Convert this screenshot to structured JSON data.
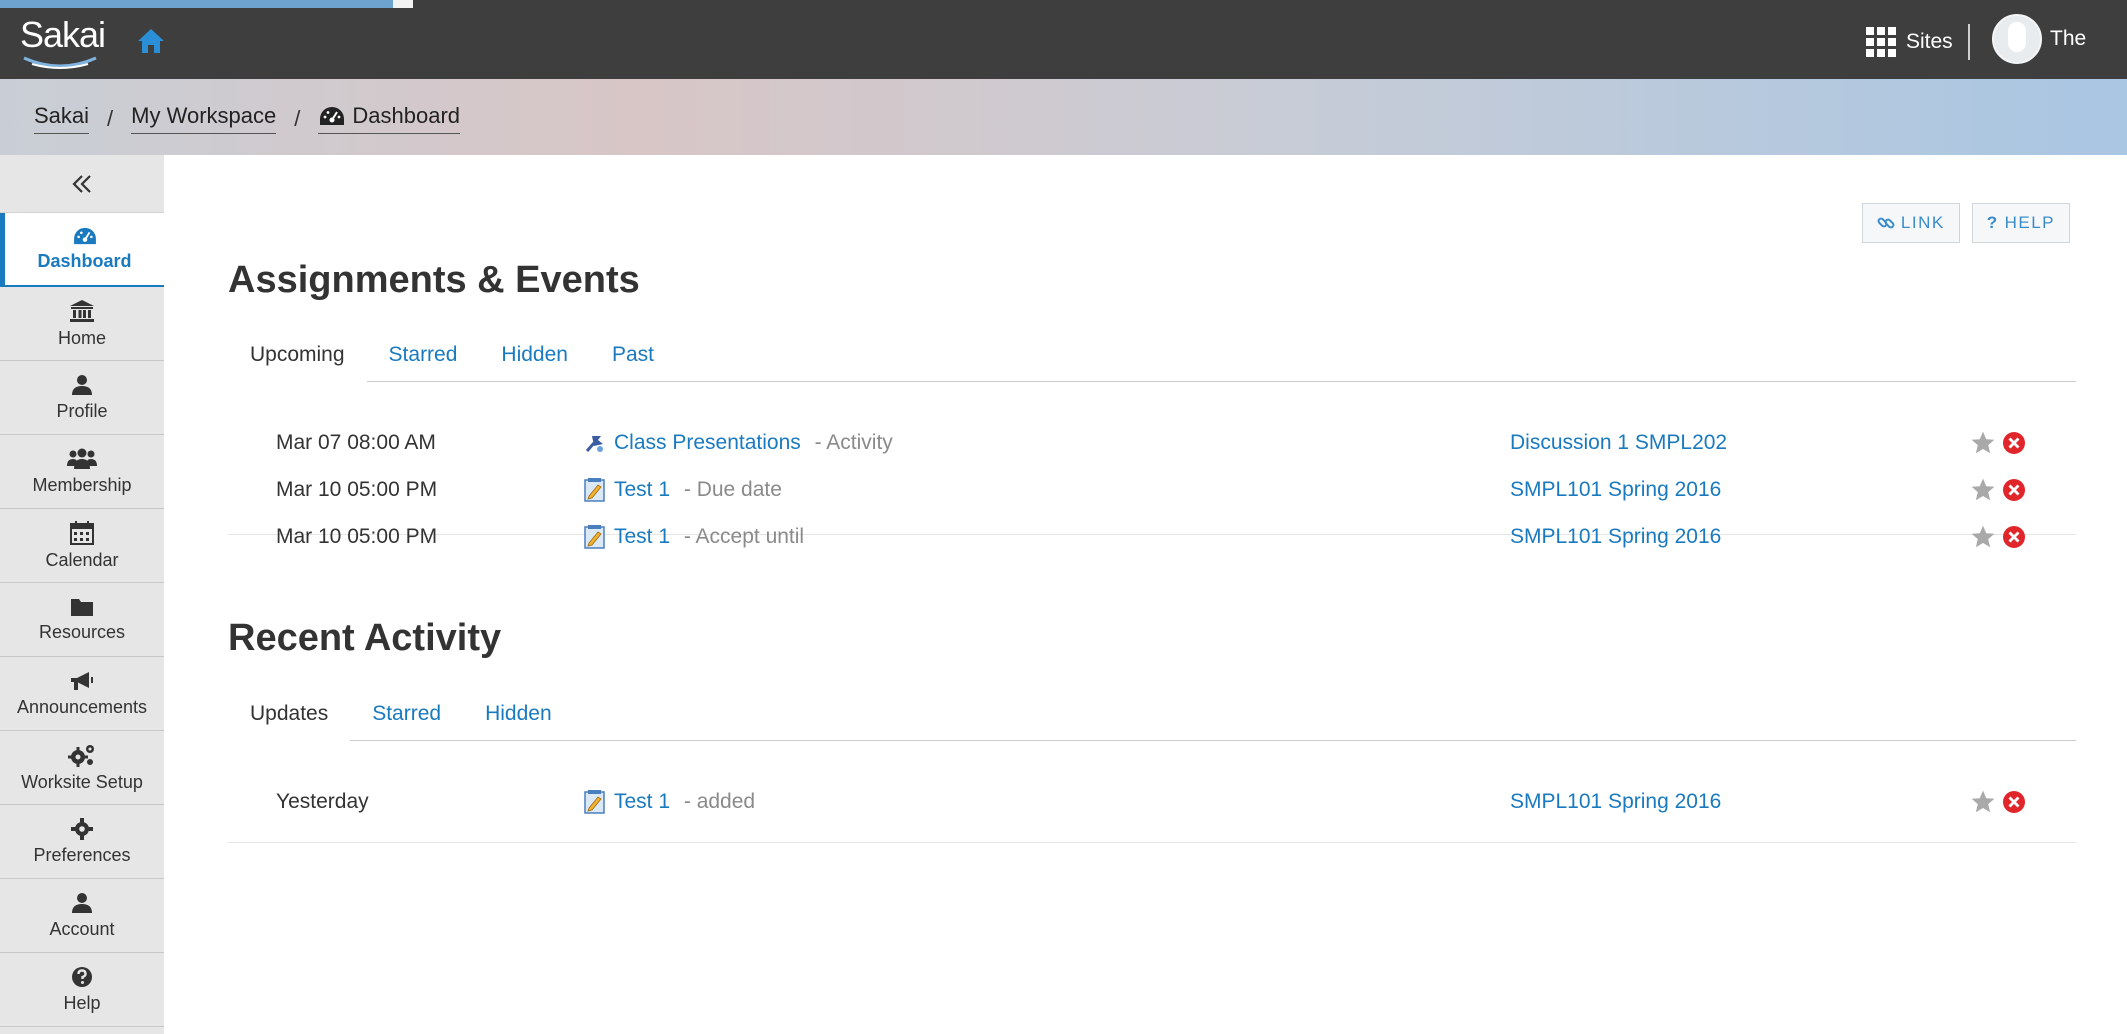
{
  "header": {
    "logo_text": "Sakai",
    "sites_label": "Sites",
    "user_name": "The"
  },
  "breadcrumb": {
    "items": [
      "Sakai",
      "My Workspace",
      "Dashboard"
    ],
    "separator": "/"
  },
  "sidebar": {
    "items": [
      {
        "label": "Dashboard",
        "icon": "dashboard-icon",
        "active": true
      },
      {
        "label": "Home",
        "icon": "institution-icon"
      },
      {
        "label": "Profile",
        "icon": "user-icon"
      },
      {
        "label": "Membership",
        "icon": "users-icon"
      },
      {
        "label": "Calendar",
        "icon": "calendar-icon"
      },
      {
        "label": "Resources",
        "icon": "folder-icon"
      },
      {
        "label": "Announcements",
        "icon": "megaphone-icon"
      },
      {
        "label": "Worksite Setup",
        "icon": "gears-icon"
      },
      {
        "label": "Preferences",
        "icon": "gear-icon"
      },
      {
        "label": "Account",
        "icon": "user-icon"
      },
      {
        "label": "Help",
        "icon": "question-icon"
      }
    ]
  },
  "toolbar": {
    "link_label": "LINK",
    "help_label": "HELP"
  },
  "assignments": {
    "title": "Assignments & Events",
    "tabs": [
      "Upcoming",
      "Starred",
      "Hidden",
      "Past"
    ],
    "rows": [
      {
        "date": "Mar 07 08:00 AM",
        "icon": "activity-icon",
        "title": "Class Presentations",
        "suffix": " - Activity",
        "site": "Discussion 1 SMPL202"
      },
      {
        "date": "Mar 10 05:00 PM",
        "icon": "assignment-icon",
        "title": "Test 1",
        "suffix": " - Due date",
        "site": "SMPL101 Spring 2016"
      },
      {
        "date": "Mar 10 05:00 PM",
        "icon": "assignment-icon",
        "title": "Test 1",
        "suffix": " - Accept until",
        "site": "SMPL101 Spring 2016"
      }
    ]
  },
  "recent": {
    "title": "Recent Activity",
    "tabs": [
      "Updates",
      "Starred",
      "Hidden"
    ],
    "rows": [
      {
        "date": "Yesterday",
        "icon": "assignment-icon",
        "title": "Test 1",
        "suffix": " - added",
        "site": "SMPL101 Spring 2016"
      }
    ]
  },
  "colors": {
    "header_bg": "#3e3e3e",
    "link": "#1a7abf",
    "star": "#a9a9a9",
    "hide": "#e0262b"
  }
}
